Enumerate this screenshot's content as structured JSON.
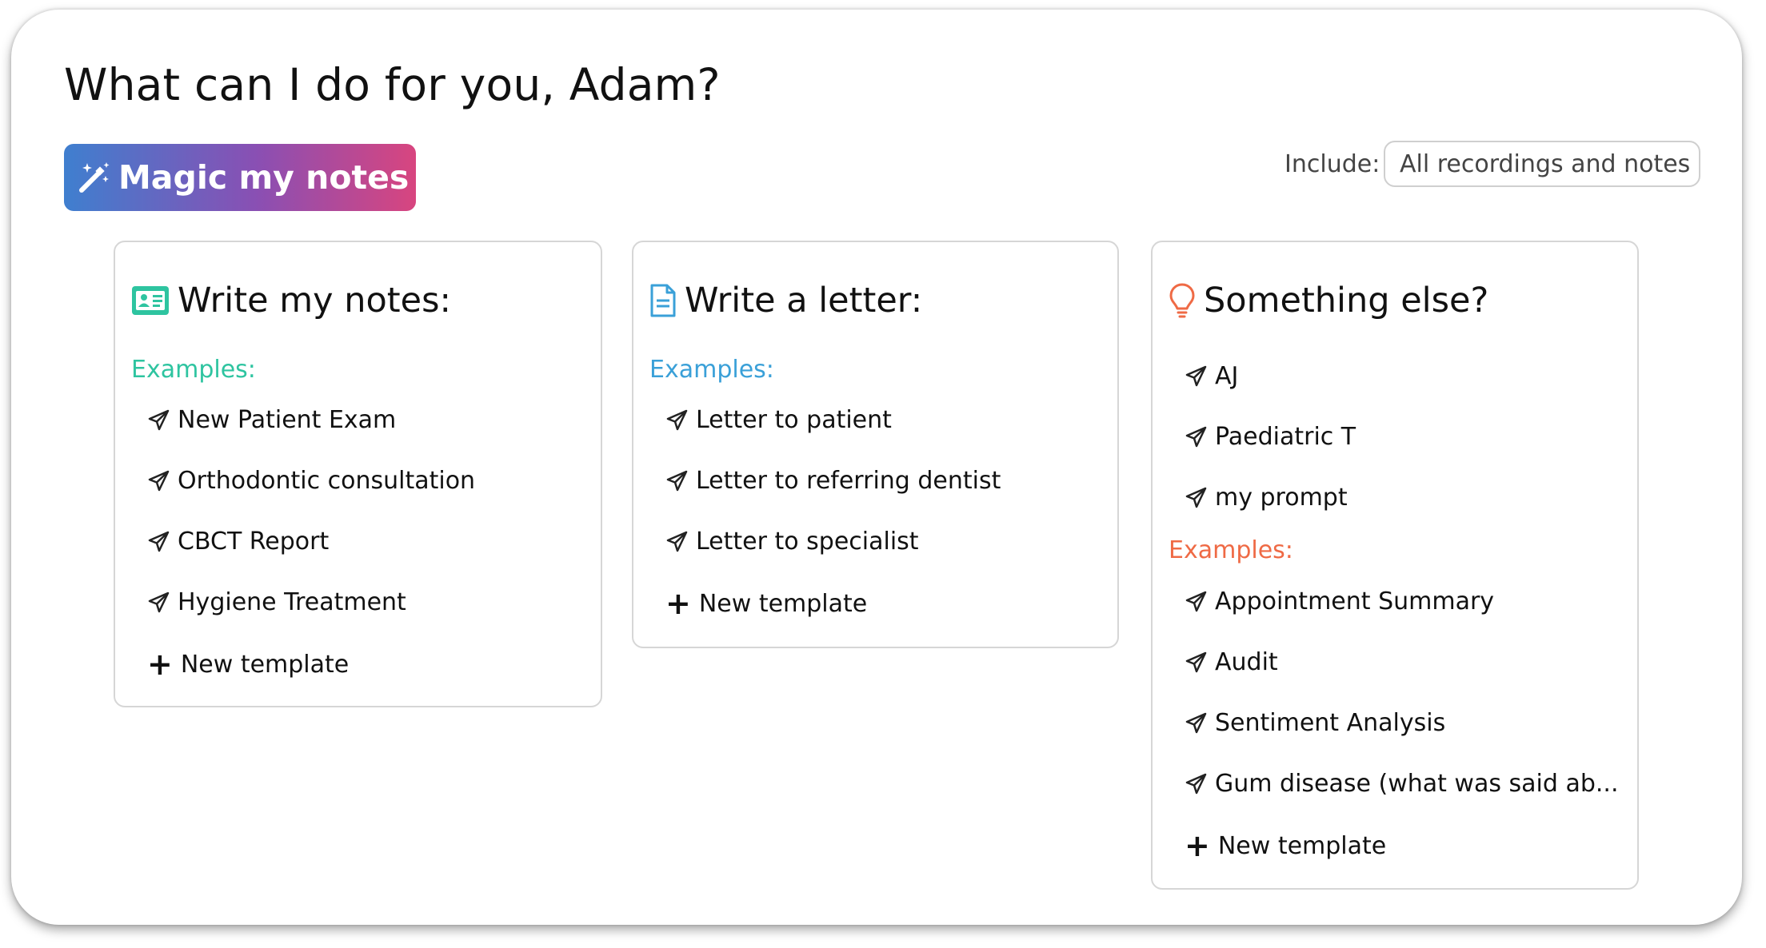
{
  "header": {
    "greeting": "What can I do for you, Adam?"
  },
  "magic_button": {
    "label": "Magic my notes",
    "icon": "magic-wand-icon"
  },
  "include": {
    "label": "Include:",
    "selected": "All recordings and notes"
  },
  "colors": {
    "notes_examples": "#2ec4a0",
    "letter_examples": "#3aa0d8",
    "else_examples": "#ef6a45"
  },
  "cards": {
    "notes": {
      "title": "Write my notes:",
      "icon": "id-card-icon",
      "examples_label": "Examples:",
      "items": [
        "New Patient Exam",
        "Orthodontic consultation",
        "CBCT Report",
        "Hygiene Treatment"
      ],
      "new_template": "New template"
    },
    "letter": {
      "title": "Write a letter:",
      "icon": "document-icon",
      "examples_label": "Examples:",
      "items": [
        "Letter to patient",
        "Letter to referring dentist",
        "Letter to specialist"
      ],
      "new_template": "New template"
    },
    "else": {
      "title": "Something else?",
      "icon": "lightbulb-icon",
      "custom_items": [
        "AJ",
        "Paediatric T",
        "my prompt"
      ],
      "examples_label": "Examples:",
      "items": [
        "Appointment Summary",
        "Audit",
        "Sentiment Analysis",
        "Gum disease (what was said ab..."
      ],
      "new_template": "New template"
    }
  }
}
